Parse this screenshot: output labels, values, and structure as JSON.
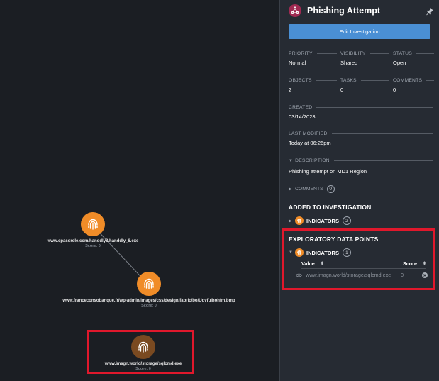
{
  "graph": {
    "nodes": [
      {
        "label": "www.cpasdrole.com/handdly8/handdly_6.exe",
        "score": "Score: 0"
      },
      {
        "label": "www.franceconsobanque.fr/wp-admin/images/css/design/fabric/bo/Uqvfulhohfm.bmp",
        "score": "Score: 0"
      },
      {
        "label": "www.imagn.world/storage/sqlcmd.exe",
        "score": "Score: 0"
      }
    ]
  },
  "panel": {
    "title": "Phishing Attempt",
    "edit_button": "Edit Investigation",
    "priority": {
      "label": "PRIORITY",
      "value": "Normal"
    },
    "visibility": {
      "label": "VISIBILITY",
      "value": "Shared"
    },
    "status": {
      "label": "STATUS",
      "value": "Open"
    },
    "objects": {
      "label": "OBJECTS",
      "value": "2"
    },
    "tasks": {
      "label": "TASKS",
      "value": "0"
    },
    "comments_count": {
      "label": "COMMENTS",
      "value": "0"
    },
    "created": {
      "label": "CREATED",
      "value": "03/14/2023"
    },
    "last_modified": {
      "label": "LAST MODIFIED",
      "value": "Today at 06:26pm"
    },
    "description": {
      "label": "DESCRIPTION",
      "value": "Phishing attempt on MD1 Region"
    },
    "comments_toggle": {
      "label": "COMMENTS",
      "count": "0"
    },
    "added": {
      "title": "ADDED TO INVESTIGATION",
      "indicators_label": "INDICATORS",
      "indicators_count": "2"
    },
    "exploratory": {
      "title": "EXPLORATORY DATA POINTS",
      "indicators_label": "INDICATORS",
      "indicators_count": "1",
      "columns": [
        "Value",
        "Score"
      ],
      "rows": [
        {
          "value": "www.imagn.world/storage/sqlcmd.exe",
          "score": "0"
        }
      ]
    }
  },
  "icons": {
    "logo": "investigation-logo-icon",
    "pin": "pin-icon",
    "indicator": "fingerprint-icon",
    "eye": "eye-icon",
    "remove": "remove-icon"
  },
  "colors": {
    "indicator_node": "#f08c28",
    "selected_node": "#7a4a21",
    "highlight": "#e0182c",
    "button": "#4a8fd4",
    "logo": "#a02a52"
  }
}
